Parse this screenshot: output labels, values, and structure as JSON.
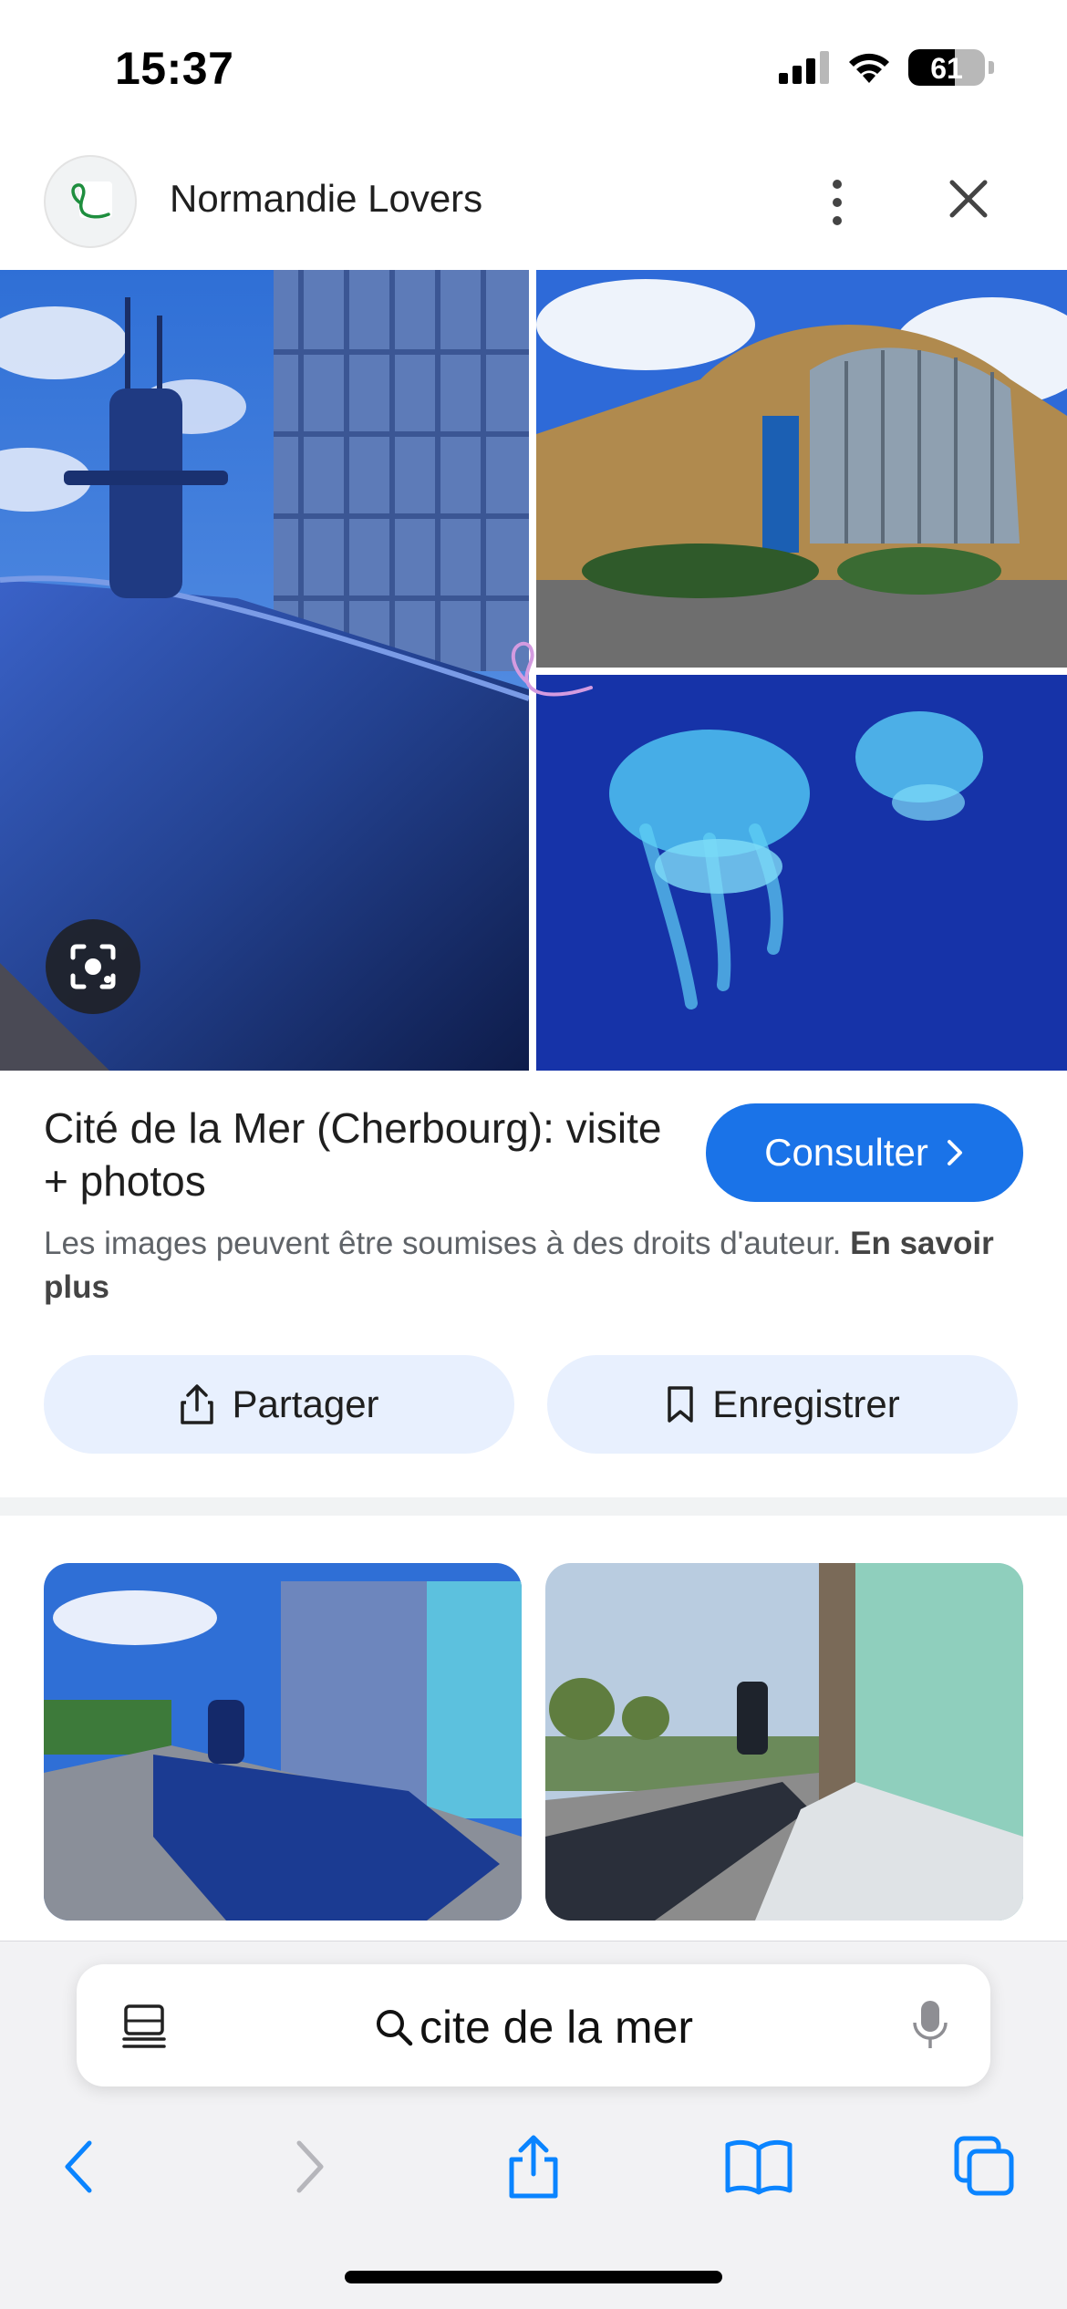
{
  "status_bar": {
    "time": "15:37",
    "battery_level": "61",
    "battery_fraction": 0.61,
    "icons": [
      "cellular-signal-icon",
      "wifi-icon",
      "battery-icon"
    ]
  },
  "header": {
    "site_name": "Normandie Lovers",
    "logo_icon": "normandie-lovers-heart-logo",
    "more_icon": "vertical-dots-icon",
    "close_icon": "close-icon"
  },
  "result": {
    "title": "Cité de la Mer (Cherbourg): visite + photos",
    "consult_label": "Consulter",
    "copyright_text": "Les images peuvent être soumises à des droits d'auteur.",
    "learn_more_label": "En savoir plus",
    "share_label": "Partager",
    "save_label": "Enregistrer"
  },
  "browser": {
    "search_query": "cite de la mer",
    "icons": {
      "reader": "reader-mode-icon",
      "search": "search-icon",
      "mic": "microphone-icon",
      "back": "back-chevron-icon",
      "forward": "forward-chevron-icon",
      "share": "share-icon",
      "bookmarks": "bookmarks-book-icon",
      "tabs": "tabs-icon"
    }
  },
  "colors": {
    "accent": "#1a73e8",
    "chip_bg": "#e8f0fe",
    "logo_green": "#1e8e3e",
    "ios_blue": "#0a84ff"
  }
}
